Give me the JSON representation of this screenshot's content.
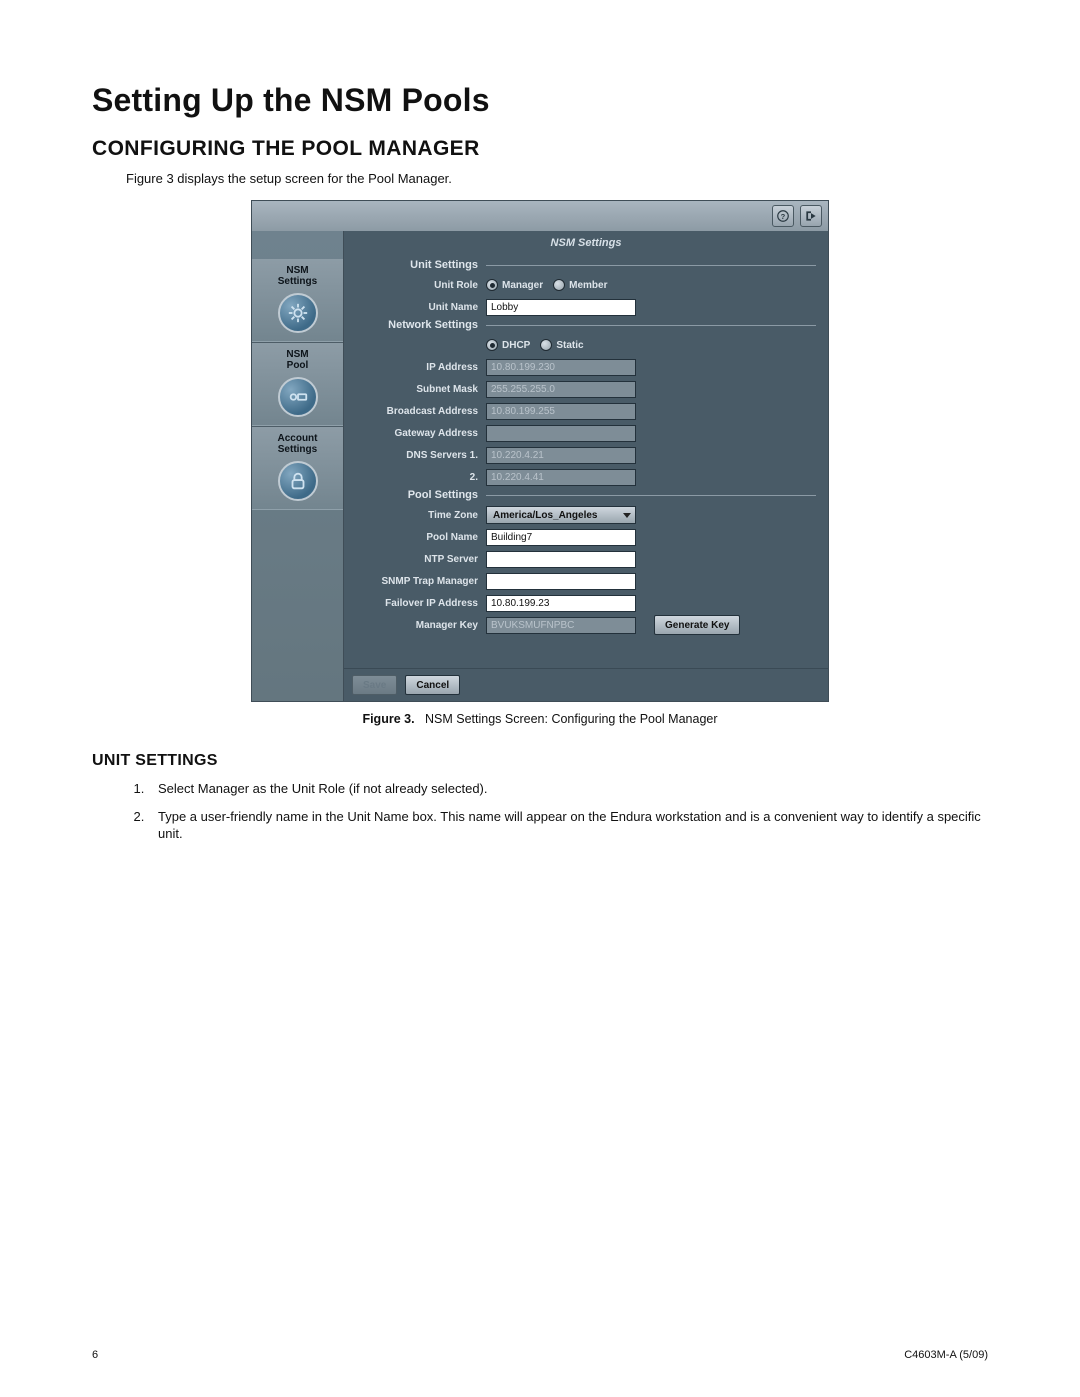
{
  "doc": {
    "title": "Setting Up the NSM Pools",
    "section": "CONFIGURING THE POOL MANAGER",
    "intro": "Figure 3 displays the setup screen for the Pool Manager.",
    "caption_prefix": "Figure 3.",
    "caption_text": "NSM Settings Screen: Configuring the Pool Manager",
    "subsection": "UNIT SETTINGS",
    "steps": [
      "Select Manager as the Unit Role (if not already selected).",
      "Type a user-friendly name in the Unit Name box. This name will appear on the Endura workstation and is a convenient way to identify a specific unit."
    ],
    "page_number": "6",
    "doc_code": "C4603M-A (5/09)"
  },
  "app": {
    "sidebar": {
      "items": [
        {
          "line1": "NSM",
          "line2": "Settings",
          "icon": "gear"
        },
        {
          "line1": "NSM",
          "line2": "Pool",
          "icon": "pool"
        },
        {
          "line1": "Account",
          "line2": "Settings",
          "icon": "lock"
        }
      ]
    },
    "titlebar_icons": {
      "help": "help-icon",
      "exit": "exit-icon"
    },
    "panel_title": "NSM Settings",
    "groups": {
      "unit": {
        "header": "Unit Settings",
        "role_label": "Unit Role",
        "role_options": {
          "manager": "Manager",
          "member": "Member"
        },
        "role_selected": "manager",
        "name_label": "Unit Name",
        "name_value": "Lobby"
      },
      "network": {
        "header": "Network Settings",
        "mode_options": {
          "dhcp": "DHCP",
          "static": "Static"
        },
        "mode_selected": "dhcp",
        "ip_label": "IP Address",
        "ip_value": "10.80.199.230",
        "subnet_label": "Subnet Mask",
        "subnet_value": "255.255.255.0",
        "broadcast_label": "Broadcast Address",
        "broadcast_value": "10.80.199.255",
        "gateway_label": "Gateway Address",
        "gateway_value": "",
        "dns1_label": "DNS Servers   1.",
        "dns1_value": "10.220.4.21",
        "dns2_label": "2.",
        "dns2_value": "10.220.4.41"
      },
      "pool": {
        "header": "Pool Settings",
        "tz_label": "Time Zone",
        "tz_value": "America/Los_Angeles",
        "poolname_label": "Pool Name",
        "poolname_value": "Building7",
        "ntp_label": "NTP Server",
        "ntp_value": "",
        "snmp_label": "SNMP Trap Manager",
        "snmp_value": "",
        "failover_label": "Failover IP Address",
        "failover_value": "10.80.199.23",
        "key_label": "Manager Key",
        "key_value": "BVUKSMUFNPBC",
        "gen_key_label": "Generate Key"
      }
    },
    "buttons": {
      "save": "Save",
      "cancel": "Cancel"
    }
  }
}
